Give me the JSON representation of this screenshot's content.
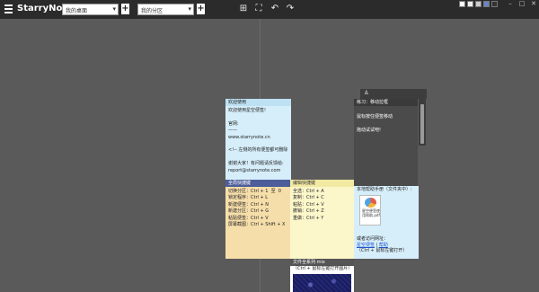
{
  "app": {
    "title": "StarryNote"
  },
  "toolbar": {
    "desk_select": "我的桌面",
    "group_select": "我的分区",
    "add_label": "+",
    "tools": [
      {
        "icon": "new-note-icon",
        "glyph": "⊞"
      },
      {
        "icon": "screen-capture-icon",
        "glyph": "⛶"
      },
      {
        "icon": "undo-icon",
        "glyph": "↶"
      },
      {
        "icon": "redo-icon",
        "glyph": "↷"
      }
    ],
    "swatches": [
      "#ffffff",
      "#eeeeee",
      "#cccccc",
      "#6b83c9",
      "#333333"
    ],
    "window_controls": [
      "–",
      "□",
      "✕"
    ]
  },
  "notes": {
    "welcome": {
      "title": "欢迎使用",
      "body": "欢迎使用星空便签!\n\n官网:\n——\nwww.starrynote.cn\n\n<!-- 左侧的所有便签都可删除\n\n谢谢大家！有问题请反馈给:\nreport@starrynote.com"
    },
    "shortcuts": {
      "title": "全局快捷键",
      "body": "切换分区：Ctrl + 1  至  0\n锁定程序：Ctrl + L\n新建便签：Ctrl + N\n新建分区：Ctrl + G\n粘贴便签：Ctrl + V\n屏幕截图：Ctrl + Shift + X"
    },
    "edit_shortcuts": {
      "title": "编辑快捷键",
      "body": "全选：Ctrl + A\n复制：Ctrl + C\n粘贴：Ctrl + V\n撤销：Ctrl + Z\n重做：Ctrl + Y"
    },
    "drag": {
      "title": "练习：移动拉框",
      "body": "\n鼠标按住便签移动\n\n拖动试试吧!"
    },
    "help": {
      "title": "本地帮助手册（文件夹中）:",
      "file_label": "星空便签使用帮助.pdf",
      "visit_label": "或者访问网址：",
      "link1": "星空便签",
      "sep": " | ",
      "link2": "帮助",
      "hint": "（Ctrl + 鼠标左键打开）"
    },
    "series": {
      "title": "文件全系列 mix",
      "subtitle": "（Ctrl + 鼠标左键打开图片）"
    }
  }
}
